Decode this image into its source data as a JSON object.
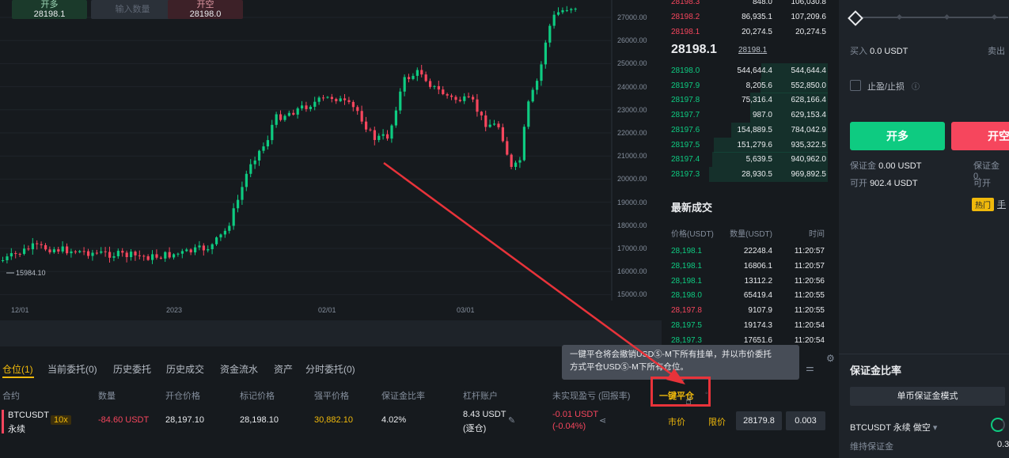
{
  "top_boxes": {
    "long_label": "开多",
    "long_price": "28198.1",
    "qty_placeholder": "输入数量",
    "short_label": "开空",
    "short_price": "28198.0"
  },
  "chart": {
    "y_labels": [
      "27000.00",
      "26000.00",
      "25000.00",
      "24000.00",
      "23000.00",
      "22000.00",
      "21000.00",
      "20000.00",
      "19000.00",
      "18000.00",
      "17000.00",
      "16000.00",
      "15000.00"
    ],
    "x_labels": [
      "12/01",
      "2023",
      "02/01",
      "03/01"
    ],
    "min_label": "15984.10"
  },
  "orderbook": {
    "asks": [
      [
        "28198.3",
        "848.0",
        "106,030.8"
      ],
      [
        "28198.2",
        "86,935.1",
        "107,209.6"
      ],
      [
        "28198.1",
        "20,274.5",
        "20,274.5"
      ]
    ],
    "last_price": "28198.1",
    "mark_price": "28198.1",
    "bids": [
      [
        "28198.0",
        "544,644.4",
        "544,644.4"
      ],
      [
        "28197.9",
        "8,205.6",
        "552,850.0"
      ],
      [
        "28197.8",
        "75,316.4",
        "628,166.4"
      ],
      [
        "28197.7",
        "987.0",
        "629,153.4"
      ],
      [
        "28197.6",
        "154,889.5",
        "784,042.9"
      ],
      [
        "28197.5",
        "151,279.6",
        "935,322.5"
      ],
      [
        "28197.4",
        "5,639.5",
        "940,962.0"
      ],
      [
        "28197.3",
        "28,930.5",
        "969,892.5"
      ]
    ],
    "bid_depth": [
      0.56,
      0.57,
      0.65,
      0.65,
      0.81,
      0.96,
      0.97,
      1.0
    ]
  },
  "trades": {
    "title": "最新成交",
    "headers": [
      "价格(USDT)",
      "数量(USDT)",
      "时间"
    ],
    "rows": [
      [
        "28,198.1",
        "22248.4",
        "11:20:57",
        "g"
      ],
      [
        "28,198.1",
        "16806.1",
        "11:20:57",
        "g"
      ],
      [
        "28,198.1",
        "13112.2",
        "11:20:56",
        "g"
      ],
      [
        "28,198.0",
        "65419.4",
        "11:20:55",
        "g"
      ],
      [
        "28,197.8",
        "9107.9",
        "11:20:55",
        "r"
      ],
      [
        "28,197.5",
        "19174.3",
        "11:20:54",
        "g"
      ],
      [
        "28,197.3",
        "17651.6",
        "11:20:54",
        "g"
      ]
    ]
  },
  "right": {
    "buy_label": "买入",
    "buy_value": "0.0 USDT",
    "sell_label": "卖出",
    "tpsl_label": "止盈/止损",
    "open_long": "开多",
    "open_short": "开空",
    "margin_label": "保证金",
    "margin_value": "0.00 USDT",
    "margin2": "保证金 0.",
    "can_open_label": "可开",
    "can_open_value": "902.4 USDT",
    "can_open2": "可开",
    "hot_badge": "热门",
    "hot_text": "手",
    "margin_ratio_title": "保证金比率",
    "single_margin_mode": "单币保证金模式",
    "position_name": "BTCUSDT 永续 做空",
    "maintenance_margin": "维持保证金",
    "maint_value": "0.3"
  },
  "bottom": {
    "tabs": [
      "仓位(1)",
      "当前委托(0)",
      "历史委托",
      "历史成交",
      "资金流水",
      "资产",
      "分时委托(0)"
    ],
    "headers": [
      "合约",
      "数量",
      "开仓价格",
      "标记价格",
      "强平价格",
      "保证金比率",
      "杠杆账户",
      "未实现盈亏 (回报率)"
    ],
    "row": {
      "symbol": "BTCUSDT",
      "type": "永续",
      "leverage": "10x",
      "qty": "-84.60 USDT",
      "entry": "28,197.10",
      "mark": "28,198.10",
      "liq": "30,882.10",
      "margin_ratio": "4.02%",
      "margin": "8.43 USDT",
      "margin_mode": "(逐仓)",
      "pnl": "-0.01 USDT",
      "pnl_pct": "(-0.04%)"
    },
    "close_all": "一键平仓",
    "market": "市价",
    "limit": "限价",
    "limit_price": "28179.8",
    "limit_qty": "0.003"
  },
  "tooltip": {
    "line1": "一键平仓将会撤销USDⓈ-M下所有挂单，并以市价委托",
    "line2": "方式平仓USDⓈ-M下所有仓位。"
  },
  "colors": {
    "green": "#0ecb81",
    "red": "#f6465d",
    "gold": "#f0b90b",
    "annotation": "#e8333a"
  }
}
